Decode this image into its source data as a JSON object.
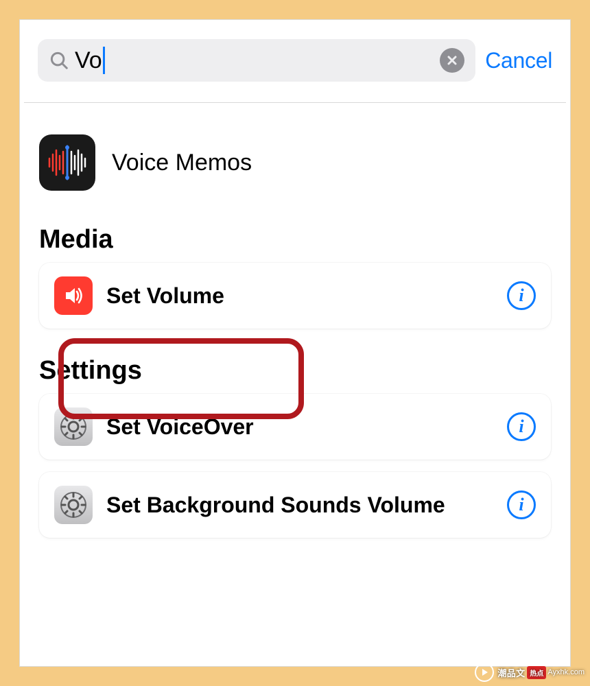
{
  "search": {
    "query": "Vo",
    "cancel_label": "Cancel"
  },
  "apps": {
    "voice_memos": {
      "label": "Voice Memos"
    }
  },
  "sections": {
    "media": {
      "title": "Media",
      "items": {
        "set_volume": {
          "label": "Set Volume"
        }
      }
    },
    "settings": {
      "title": "Settings",
      "items": {
        "set_voiceover": {
          "label": "Set VoiceOver"
        },
        "set_bg_sounds": {
          "label": "Set Background Sounds Volume"
        }
      }
    }
  },
  "watermark": {
    "text": "潮品文",
    "badge": "热点",
    "sub": "Ayxhk.com"
  }
}
